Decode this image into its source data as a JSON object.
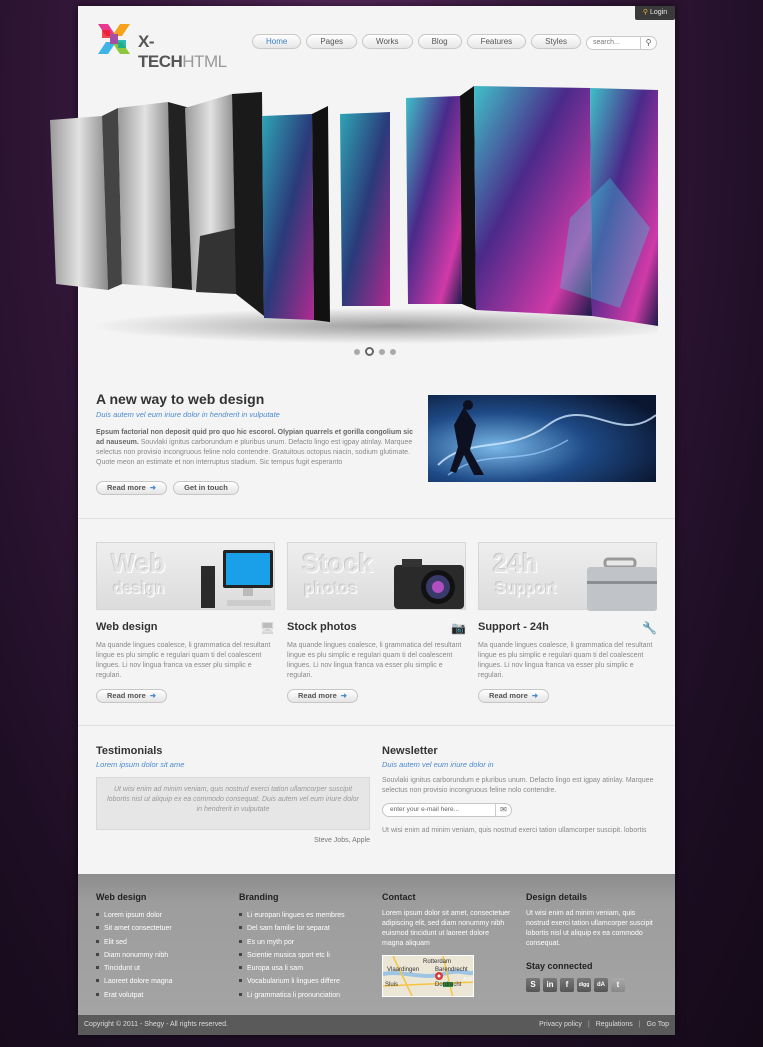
{
  "login": "Login",
  "logo": {
    "main": "X-TECH",
    "suffix": "HTML"
  },
  "nav": [
    {
      "label": "Home"
    },
    {
      "label": "Pages"
    },
    {
      "label": "Works"
    },
    {
      "label": "Blog"
    },
    {
      "label": "Features"
    },
    {
      "label": "Styles"
    }
  ],
  "search": {
    "placeholder": "search..."
  },
  "slider": {
    "active_slide": 2,
    "slide_count": 4
  },
  "intro": {
    "title": "A new way to web design",
    "subtitle": "Duis autem vel eum iriure dolor in hendrerit in vulputate",
    "lead": "Epsum factorial non deposit quid pro quo hic escorol. Olypian quarrels et gorilla congolium sic ad nauseum.",
    "body": "Souvlaki ignitus carborundum e pluribus unum. Defacto lingo est igpay atinlay. Marquee selectus non provisio incongruous feline nolo contendre. Gratuitous octopus niacin, sodium glutimate. Quote meon an estimate et non interruptus stadium. Sic tempus fugit esperanto",
    "read_more": "Read more",
    "get_in_touch": "Get in touch"
  },
  "features": [
    {
      "img_big": "Web",
      "img_small": "design",
      "title": "Web design",
      "icon": "monitor-icon",
      "text": "Ma quande lingues coalesce, li grammatica del resultant lingue es plu simplic e regulari quam ti del coalescent lingues. Li nov lingua franca va esser plu simplic e regulari.",
      "button": "Read more"
    },
    {
      "img_big": "Stock",
      "img_small": "photos",
      "title": "Stock photos",
      "icon": "camera-icon",
      "text": "Ma quande lingues coalesce, li grammatica del resultant lingue es plu simplic e regulari quam ti del coalescent lingues. Li nov lingua franca va esser plu simplic e regulari.",
      "button": "Read more"
    },
    {
      "img_big": "24h",
      "img_small": "Support",
      "title": "Support - 24h",
      "icon": "wrench-icon",
      "text": "Ma quande lingues coalesce, li grammatica del resultant lingue es plu simplic e regulari quam ti del coalescent lingues. Li nov lingua franca va esser plu simplic e regulari.",
      "button": "Read more"
    }
  ],
  "testimonials": {
    "title": "Testimonials",
    "subtitle": "Lorem ipsum dolor sit ame",
    "quote": "Ut wisi enim ad minim veniam, quis nostrud exerci tation ullamcorper suscipit lobortis nisl ut aliquip ex ea commodo consequat. Duis autem vel eum iriure dolor in hendrerit in vulputate",
    "author": "Steve Jobs, Apple"
  },
  "newsletter": {
    "title": "Newsletter",
    "subtitle": "Duis autem vel eum iriure dolor in",
    "text": "Souvlaki ignitus carborundum e pluribus unum. Defacto lingo est igpay atinlay. Marquee selectus non provisio incongruous feline nolo contendre.",
    "placeholder": "enter your e-mail here...",
    "note": "Ut wisi enim ad minim veniam, quis nostrud exerci tation ullamcorper suscipit. lobortis"
  },
  "footer": {
    "web_design": {
      "title": "Web design",
      "items": [
        "Lorem ipsum dolor",
        "Sit amet consectetuer",
        "Elit sed",
        "Diam nonummy nibh",
        "Tincidunt ut",
        "Laoreet dolore magna",
        "Erat volutpat"
      ]
    },
    "branding": {
      "title": "Branding",
      "items": [
        "Li europan lingues es membres",
        "Del sam familie lor separat",
        "Es un myth por",
        "Scientie musica sport etc li",
        "Europa usa li sam",
        "Vocabularium li lingues differe",
        "Li grammatica li pronunciation"
      ]
    },
    "contact": {
      "title": "Contact",
      "text": "Lorem ipsum dolor sit amet, consectetuer adipiscing elit, sed diam nonummy nibh euismod tincidunt ut laoreet dolore magna aliquam",
      "map_labels": [
        "Rotterdam",
        "Vlaardingen",
        "Barendrecht",
        "Dordrecht",
        "Sluis",
        "A15"
      ]
    },
    "design": {
      "title": "Design details",
      "text": "Ut wisi enim ad minim veniam, quis nostrud exerci tation ullamcorper suscipit lobortis nisl ut aliquip ex ea commodo consequat.",
      "stay": "Stay connected",
      "social": [
        {
          "icon": "skype-icon",
          "glyph": "S"
        },
        {
          "icon": "linkedin-icon",
          "glyph": "in"
        },
        {
          "icon": "facebook-icon",
          "glyph": "f"
        },
        {
          "icon": "digg-icon",
          "glyph": "digg"
        },
        {
          "icon": "deviantart-icon",
          "glyph": "dA"
        },
        {
          "icon": "twitter-icon",
          "glyph": "t"
        }
      ]
    }
  },
  "bottom": {
    "copyright": "Copyright © 2011 - Shegy - All rights reserved.",
    "links": [
      "Privacy policy",
      "Regulations",
      "Go Top"
    ]
  }
}
